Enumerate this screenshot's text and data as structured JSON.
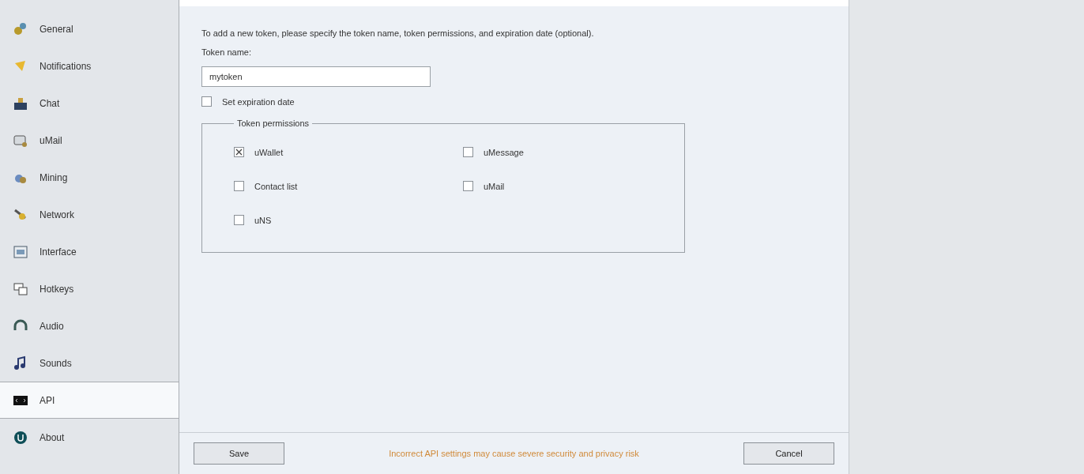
{
  "sidebar": {
    "items": [
      {
        "label": "General",
        "selected": false
      },
      {
        "label": "Notifications",
        "selected": false
      },
      {
        "label": "Chat",
        "selected": false
      },
      {
        "label": "uMail",
        "selected": false
      },
      {
        "label": "Mining",
        "selected": false
      },
      {
        "label": "Network",
        "selected": false
      },
      {
        "label": "Interface",
        "selected": false
      },
      {
        "label": "Hotkeys",
        "selected": false
      },
      {
        "label": "Audio",
        "selected": false
      },
      {
        "label": "Sounds",
        "selected": false
      },
      {
        "label": "API",
        "selected": true
      },
      {
        "label": "About",
        "selected": false
      }
    ]
  },
  "form": {
    "intro": "To add a new token, please specify the token name, token permissions, and expiration date (optional).",
    "token_name_label": "Token name:",
    "token_name": {
      "value": "mytoken"
    },
    "expiration": {
      "label": "Set expiration date",
      "checked": false
    },
    "permissions": {
      "title": "Token permissions",
      "items": [
        {
          "label": "uWallet",
          "checked": true
        },
        {
          "label": "uMessage",
          "checked": false
        },
        {
          "label": "Contact list",
          "checked": false
        },
        {
          "label": "uMail",
          "checked": false
        },
        {
          "label": "uNS",
          "checked": false
        }
      ]
    }
  },
  "footer": {
    "save": "Save",
    "warning": "Incorrect API settings may cause severe security and privacy risk",
    "cancel": "Cancel"
  }
}
